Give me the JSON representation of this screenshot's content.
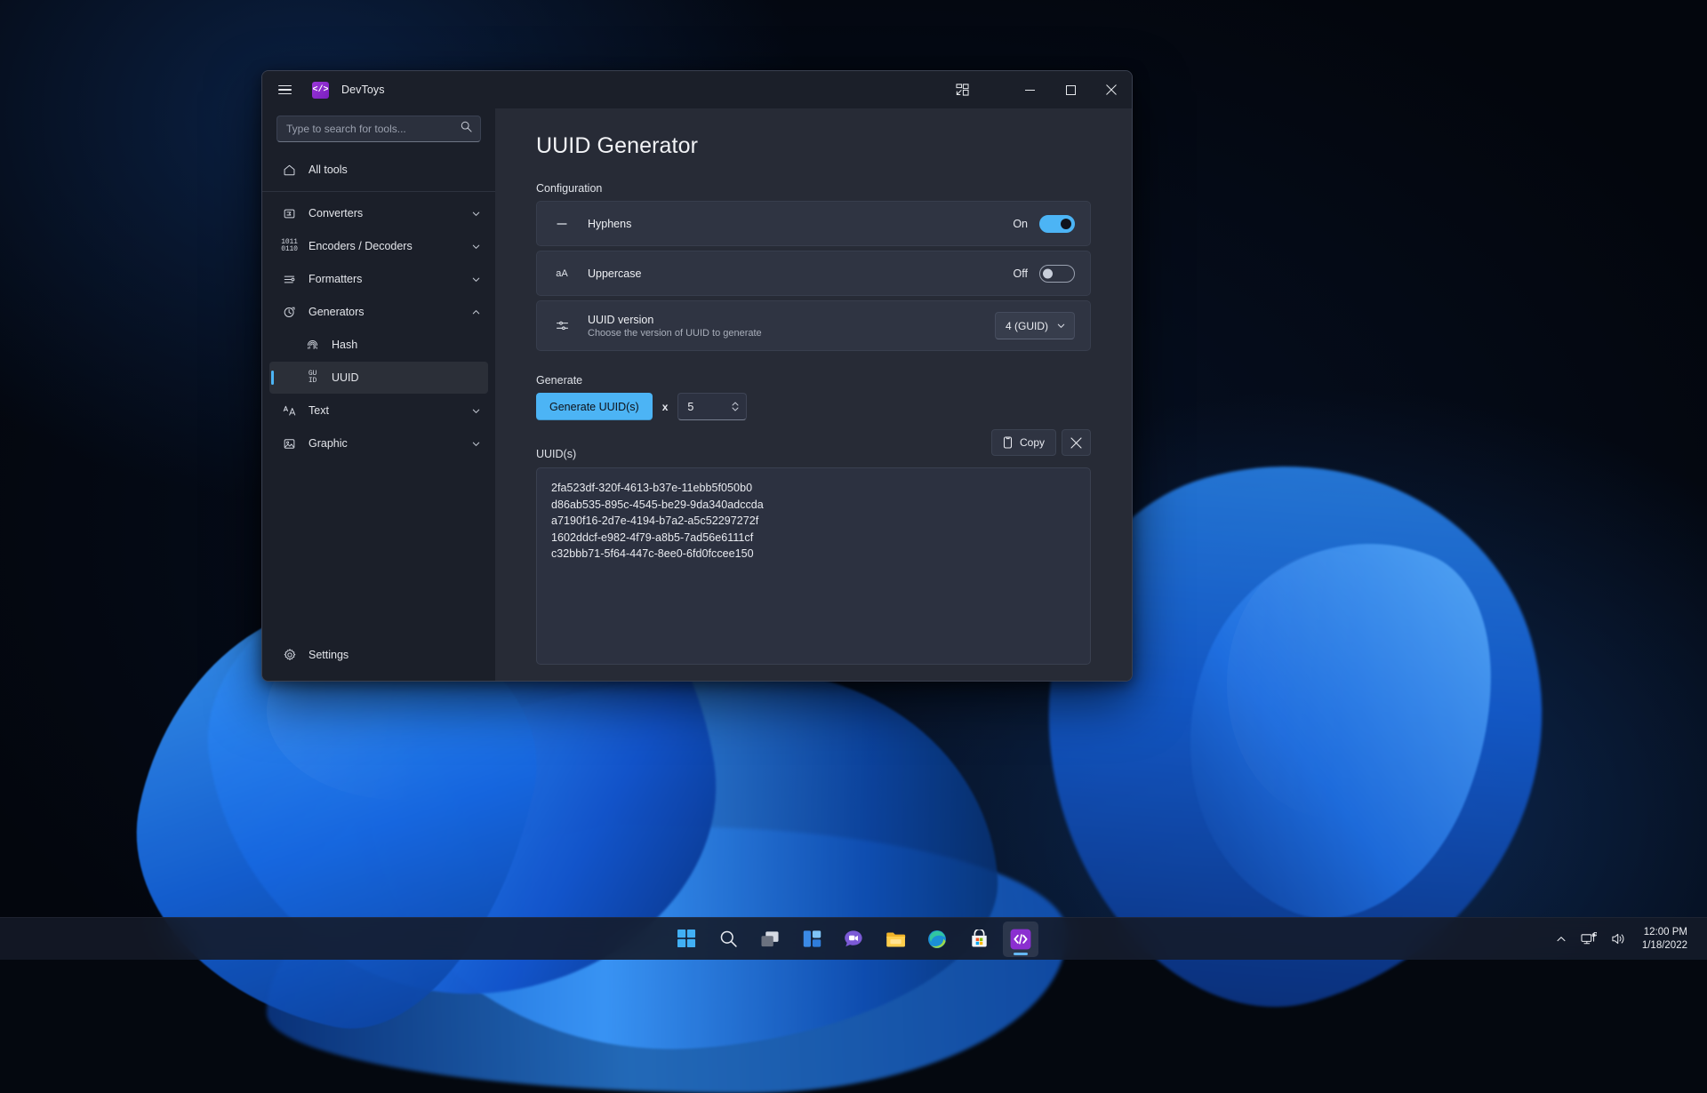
{
  "window": {
    "title": "DevToys",
    "logo_glyph": "</>",
    "controls": {
      "menu": "hamburger-menu",
      "compact_overlay": "Compact overlay",
      "minimize": "Minimize",
      "maximize": "Maximize",
      "close": "Close"
    }
  },
  "search": {
    "placeholder": "Type to search for tools...",
    "value": ""
  },
  "sidebar": {
    "items": [
      {
        "label": "All tools",
        "icon": "home-icon",
        "expandable": false,
        "selected": false,
        "child": false
      },
      {
        "label": "Converters",
        "icon": "converters-icon",
        "expandable": true,
        "chevron": "down",
        "selected": false,
        "child": false
      },
      {
        "label": "Encoders / Decoders",
        "icon": "binary-icon",
        "expandable": true,
        "chevron": "down",
        "selected": false,
        "child": false
      },
      {
        "label": "Formatters",
        "icon": "formatters-icon",
        "expandable": true,
        "chevron": "down",
        "selected": false,
        "child": false
      },
      {
        "label": "Generators",
        "icon": "generators-icon",
        "expandable": true,
        "chevron": "up",
        "selected": false,
        "child": false
      },
      {
        "label": "Hash",
        "icon": "fingerprint-icon",
        "expandable": false,
        "selected": false,
        "child": true
      },
      {
        "label": "UUID",
        "icon": "guid-icon",
        "expandable": false,
        "selected": true,
        "child": true
      },
      {
        "label": "Text",
        "icon": "text-icon",
        "expandable": true,
        "chevron": "down",
        "selected": false,
        "child": false
      },
      {
        "label": "Graphic",
        "icon": "graphic-icon",
        "expandable": true,
        "chevron": "down",
        "selected": false,
        "child": false
      }
    ],
    "settings": {
      "label": "Settings",
      "icon": "gear-icon"
    }
  },
  "main": {
    "page_title": "UUID Generator",
    "configuration_label": "Configuration",
    "settings": [
      {
        "title": "Hyphens",
        "subtitle": "",
        "icon": "hyphen-icon",
        "state_label": "On",
        "state": "on"
      },
      {
        "title": "Uppercase",
        "subtitle": "",
        "icon": "uppercase-icon",
        "state_label": "Off",
        "state": "off"
      }
    ],
    "version_setting": {
      "title": "UUID version",
      "subtitle": "Choose the version of UUID to generate",
      "icon": "sliders-icon",
      "dropdown_value": "4 (GUID)",
      "dropdown_icon": "chevron-down-icon"
    },
    "generate": {
      "label": "Generate",
      "button_label": "Generate UUID(s)",
      "multiplier": "x",
      "count_value": "5",
      "stepper_icon": "stepper-icon"
    },
    "output": {
      "label": "UUID(s)",
      "copy_label": "Copy",
      "copy_icon": "copy-icon",
      "clear_icon": "close-icon",
      "uuids": [
        "2fa523df-320f-4613-b37e-11ebb5f050b0",
        "d86ab535-895c-4545-be29-9da340adccda",
        "a7190f16-2d7e-4194-b7a2-a5c52297272f",
        "1602ddcf-e982-4f79-a8b5-7ad56e6111cf",
        "c32bbb71-5f64-447c-8ee0-6fd0fccee150"
      ]
    }
  },
  "taskbar": {
    "items": [
      {
        "name": "start-button",
        "label": "Start"
      },
      {
        "name": "search-button",
        "label": "Search"
      },
      {
        "name": "task-view-button",
        "label": "Task View"
      },
      {
        "name": "widgets-button",
        "label": "Widgets"
      },
      {
        "name": "chat-button",
        "label": "Chat"
      },
      {
        "name": "file-explorer-button",
        "label": "File Explorer"
      },
      {
        "name": "edge-button",
        "label": "Microsoft Edge"
      },
      {
        "name": "store-button",
        "label": "Microsoft Store"
      },
      {
        "name": "devtoys-button",
        "label": "DevToys",
        "active": true
      }
    ],
    "tray": {
      "chevron_label": "Show hidden icons",
      "network_label": "Network",
      "volume_label": "Volume",
      "time": "12:00 PM",
      "date": "1/18/2022"
    }
  },
  "colors": {
    "accent": "#4cb4f5",
    "window_bg": "#272b36",
    "sidebar_bg": "#1b1f29",
    "card_bg": "#2f3442"
  }
}
